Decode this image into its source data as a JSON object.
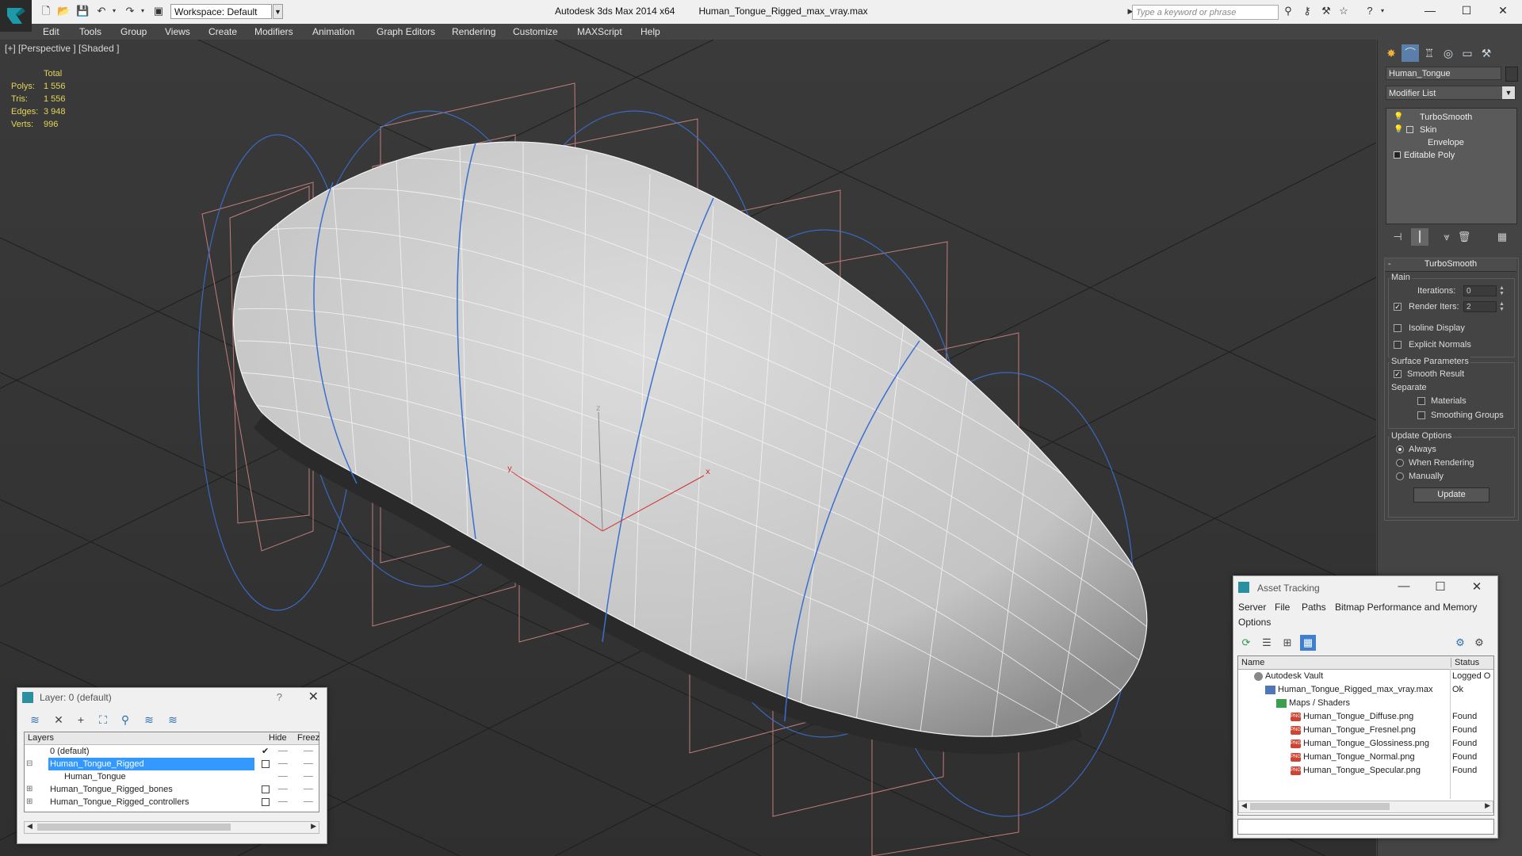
{
  "app": {
    "title": "Autodesk 3ds Max  2014 x64",
    "filename": "Human_Tongue_Rigged_max_vray.max",
    "workspace": "Workspace: Default",
    "search_placeholder": "Type a keyword or phrase"
  },
  "menu": [
    "Edit",
    "Tools",
    "Group",
    "Views",
    "Create",
    "Modifiers",
    "Animation",
    "Graph Editors",
    "Rendering",
    "Customize",
    "MAXScript",
    "Help"
  ],
  "viewport": {
    "label": "[+] [Perspective ] [Shaded ]",
    "stats_header": "Total",
    "stats": [
      {
        "k": "Polys:",
        "v": "1 556"
      },
      {
        "k": "Tris:",
        "v": "1 556"
      },
      {
        "k": "Edges:",
        "v": "3 948"
      },
      {
        "k": "Verts:",
        "v": "996"
      }
    ],
    "gizmo_labels": {
      "x": "x",
      "y": "y",
      "z": "z"
    }
  },
  "command_panel": {
    "object_name": "Human_Tongue",
    "modifier_list": "Modifier List",
    "stack": [
      "TurboSmooth",
      "Skin",
      "Envelope",
      "Editable Poly"
    ],
    "rollout_title": "TurboSmooth",
    "main_group": "Main",
    "iterations_label": "Iterations:",
    "iterations_value": "0",
    "render_iters_label": "Render Iters:",
    "render_iters_value": "2",
    "isoline_label": "Isoline Display",
    "explicit_normals_label": "Explicit Normals",
    "surface_group": "Surface Parameters",
    "smooth_result_label": "Smooth Result",
    "separate_label": "Separate",
    "materials_label": "Materials",
    "smoothing_groups_label": "Smoothing Groups",
    "update_group": "Update Options",
    "always_label": "Always",
    "when_rendering_label": "When Rendering",
    "manually_label": "Manually",
    "update_button": "Update"
  },
  "layer_dialog": {
    "title": "Layer: 0 (default)",
    "help": "?",
    "headers": {
      "layers": "Layers",
      "hide": "Hide",
      "freeze": "Freez"
    },
    "rows": [
      {
        "name": "0 (default)",
        "indent": 0
      },
      {
        "name": "Human_Tongue_Rigged",
        "indent": 0
      },
      {
        "name": "Human_Tongue",
        "indent": 1
      },
      {
        "name": "Human_Tongue_Rigged_bones",
        "indent": 0
      },
      {
        "name": "Human_Tongue_Rigged_controllers",
        "indent": 0
      }
    ]
  },
  "asset_dialog": {
    "title": "Asset Tracking",
    "menu": [
      "Server",
      "File",
      "Paths",
      "Bitmap Performance and Memory",
      "Options"
    ],
    "headers": {
      "name": "Name",
      "status": "Status"
    },
    "rows": [
      {
        "name": "Autodesk Vault",
        "status": "Logged O",
        "icon": "vault"
      },
      {
        "name": "Human_Tongue_Rigged_max_vray.max",
        "status": "Ok",
        "icon": "file"
      },
      {
        "name": "Maps / Shaders",
        "status": "",
        "icon": "folder"
      },
      {
        "name": "Human_Tongue_Diffuse.png",
        "status": "Found",
        "icon": "png"
      },
      {
        "name": "Human_Tongue_Fresnel.png",
        "status": "Found",
        "icon": "png"
      },
      {
        "name": "Human_Tongue_Glossiness.png",
        "status": "Found",
        "icon": "png"
      },
      {
        "name": "Human_Tongue_Normal.png",
        "status": "Found",
        "icon": "png"
      },
      {
        "name": "Human_Tongue_Specular.png",
        "status": "Found",
        "icon": "png"
      }
    ]
  },
  "colors": {
    "accent": "#3399ff",
    "stats": "#e3d45a",
    "bone": "#d98a8a",
    "envelope": "#3a6fd0"
  }
}
